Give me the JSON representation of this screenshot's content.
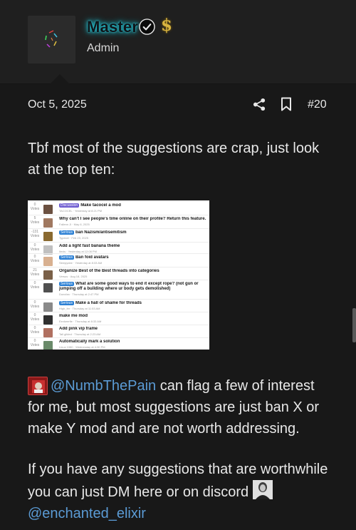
{
  "author": {
    "username": "Master",
    "title": "Admin",
    "verified_icon": "verified-check-icon",
    "badge_icon": "dollar-sign-icon",
    "badge_symbol": "$",
    "name_glow_color": "#1fb8c8"
  },
  "post": {
    "date": "Oct 5, 2025",
    "number": "#20",
    "share_icon": "share-icon",
    "bookmark_icon": "bookmark-icon",
    "paragraph1": "Tbf most of the suggestions are crap, just look at the top ten:",
    "paragraph2_mention": "@NumbThePain",
    "paragraph2_text": " can flag a few of interest for me, but most suggestions are just ban X or make Y mod and are not worth addressing.",
    "paragraph3_text": "If you have any suggestions that are worthwhile you can just DM here or on discord ",
    "paragraph3_mention": "@enchanted_elixir"
  },
  "embedded_screenshot": {
    "rows": [
      {
        "votes": "0",
        "votes_label": "Votes",
        "tag": "Discussion",
        "tag_color": "#6d5bd0",
        "title": "Make tacocel a mod",
        "meta": "TACOCEL · Yesterday at 8:21 PM",
        "avatar_color": "#6b5040"
      },
      {
        "votes": "5",
        "votes_label": "Votes",
        "tag": "",
        "tag_color": "",
        "title": "Why can't I see people's time online on their profile? Return this feature.",
        "meta": "Fallenn Ji · May 6, 2025",
        "avatar_color": "#a07860"
      },
      {
        "votes": "-131",
        "votes_label": "Votes",
        "tag": "Serious",
        "tag_color": "#2a7fd4",
        "title": "ban Nazism/antisemitism",
        "meta": "Typecel · Feb 23, 2025",
        "avatar_color": "#8a6a30"
      },
      {
        "votes": "0",
        "votes_label": "Votes",
        "tag": "",
        "tag_color": "",
        "title": "Add a light fast banana theme",
        "meta": "Ilexis · Yesterday at 12:08 PM",
        "avatar_color": "#c0c0c0"
      },
      {
        "votes": "0",
        "votes_label": "Votes",
        "tag": "Serious",
        "tag_color": "#2a7fd4",
        "title": "Ban foid avatars",
        "meta": "Sleepydee · Yesterday at 8:33 AM",
        "avatar_color": "#d8b090"
      },
      {
        "votes": "21",
        "votes_label": "Votes",
        "tag": "",
        "tag_color": "",
        "title": "Organize Best of the Best threads into categories",
        "meta": "Versus · Aug 18, 2025",
        "avatar_color": "#7a6048"
      },
      {
        "votes": "0",
        "votes_label": "Votes",
        "tag": "Serious",
        "tag_color": "#2a7fd4",
        "title": "What are some good ways to end it except rope? (not gun or",
        "title2": "jumping off a building where ur body gets demolished)",
        "meta": "Doncfan · Thursday at 2:47 PM",
        "avatar_color": "#505050"
      },
      {
        "votes": "0",
        "votes_label": "Votes",
        "tag": "Serious",
        "tag_color": "#2a7fd4",
        "title": "Make a hall of shame for threads",
        "meta": "High_fer · Thursday at 11:53 AM",
        "avatar_color": "#8a8a8a"
      },
      {
        "votes": "0",
        "votes_label": "Votes",
        "tag": "",
        "tag_color": "",
        "title": "make me mod",
        "meta": "Eevkeerfie · Thursday at 8:33 AM",
        "avatar_color": "#303030"
      },
      {
        "votes": "0",
        "votes_label": "Votes",
        "tag": "",
        "tag_color": "",
        "title": "Add pink vip frame",
        "meta": "Tall gilded · Thursday at 2:23 AM",
        "avatar_color": "#b07060"
      },
      {
        "votes": "0",
        "votes_label": "Votes",
        "tag": "",
        "tag_color": "",
        "title": "Automatically mark a solution",
        "meta": "Linux 1080 · Wednesday at 4:30 PM",
        "avatar_color": "#6a8a6a"
      }
    ]
  }
}
